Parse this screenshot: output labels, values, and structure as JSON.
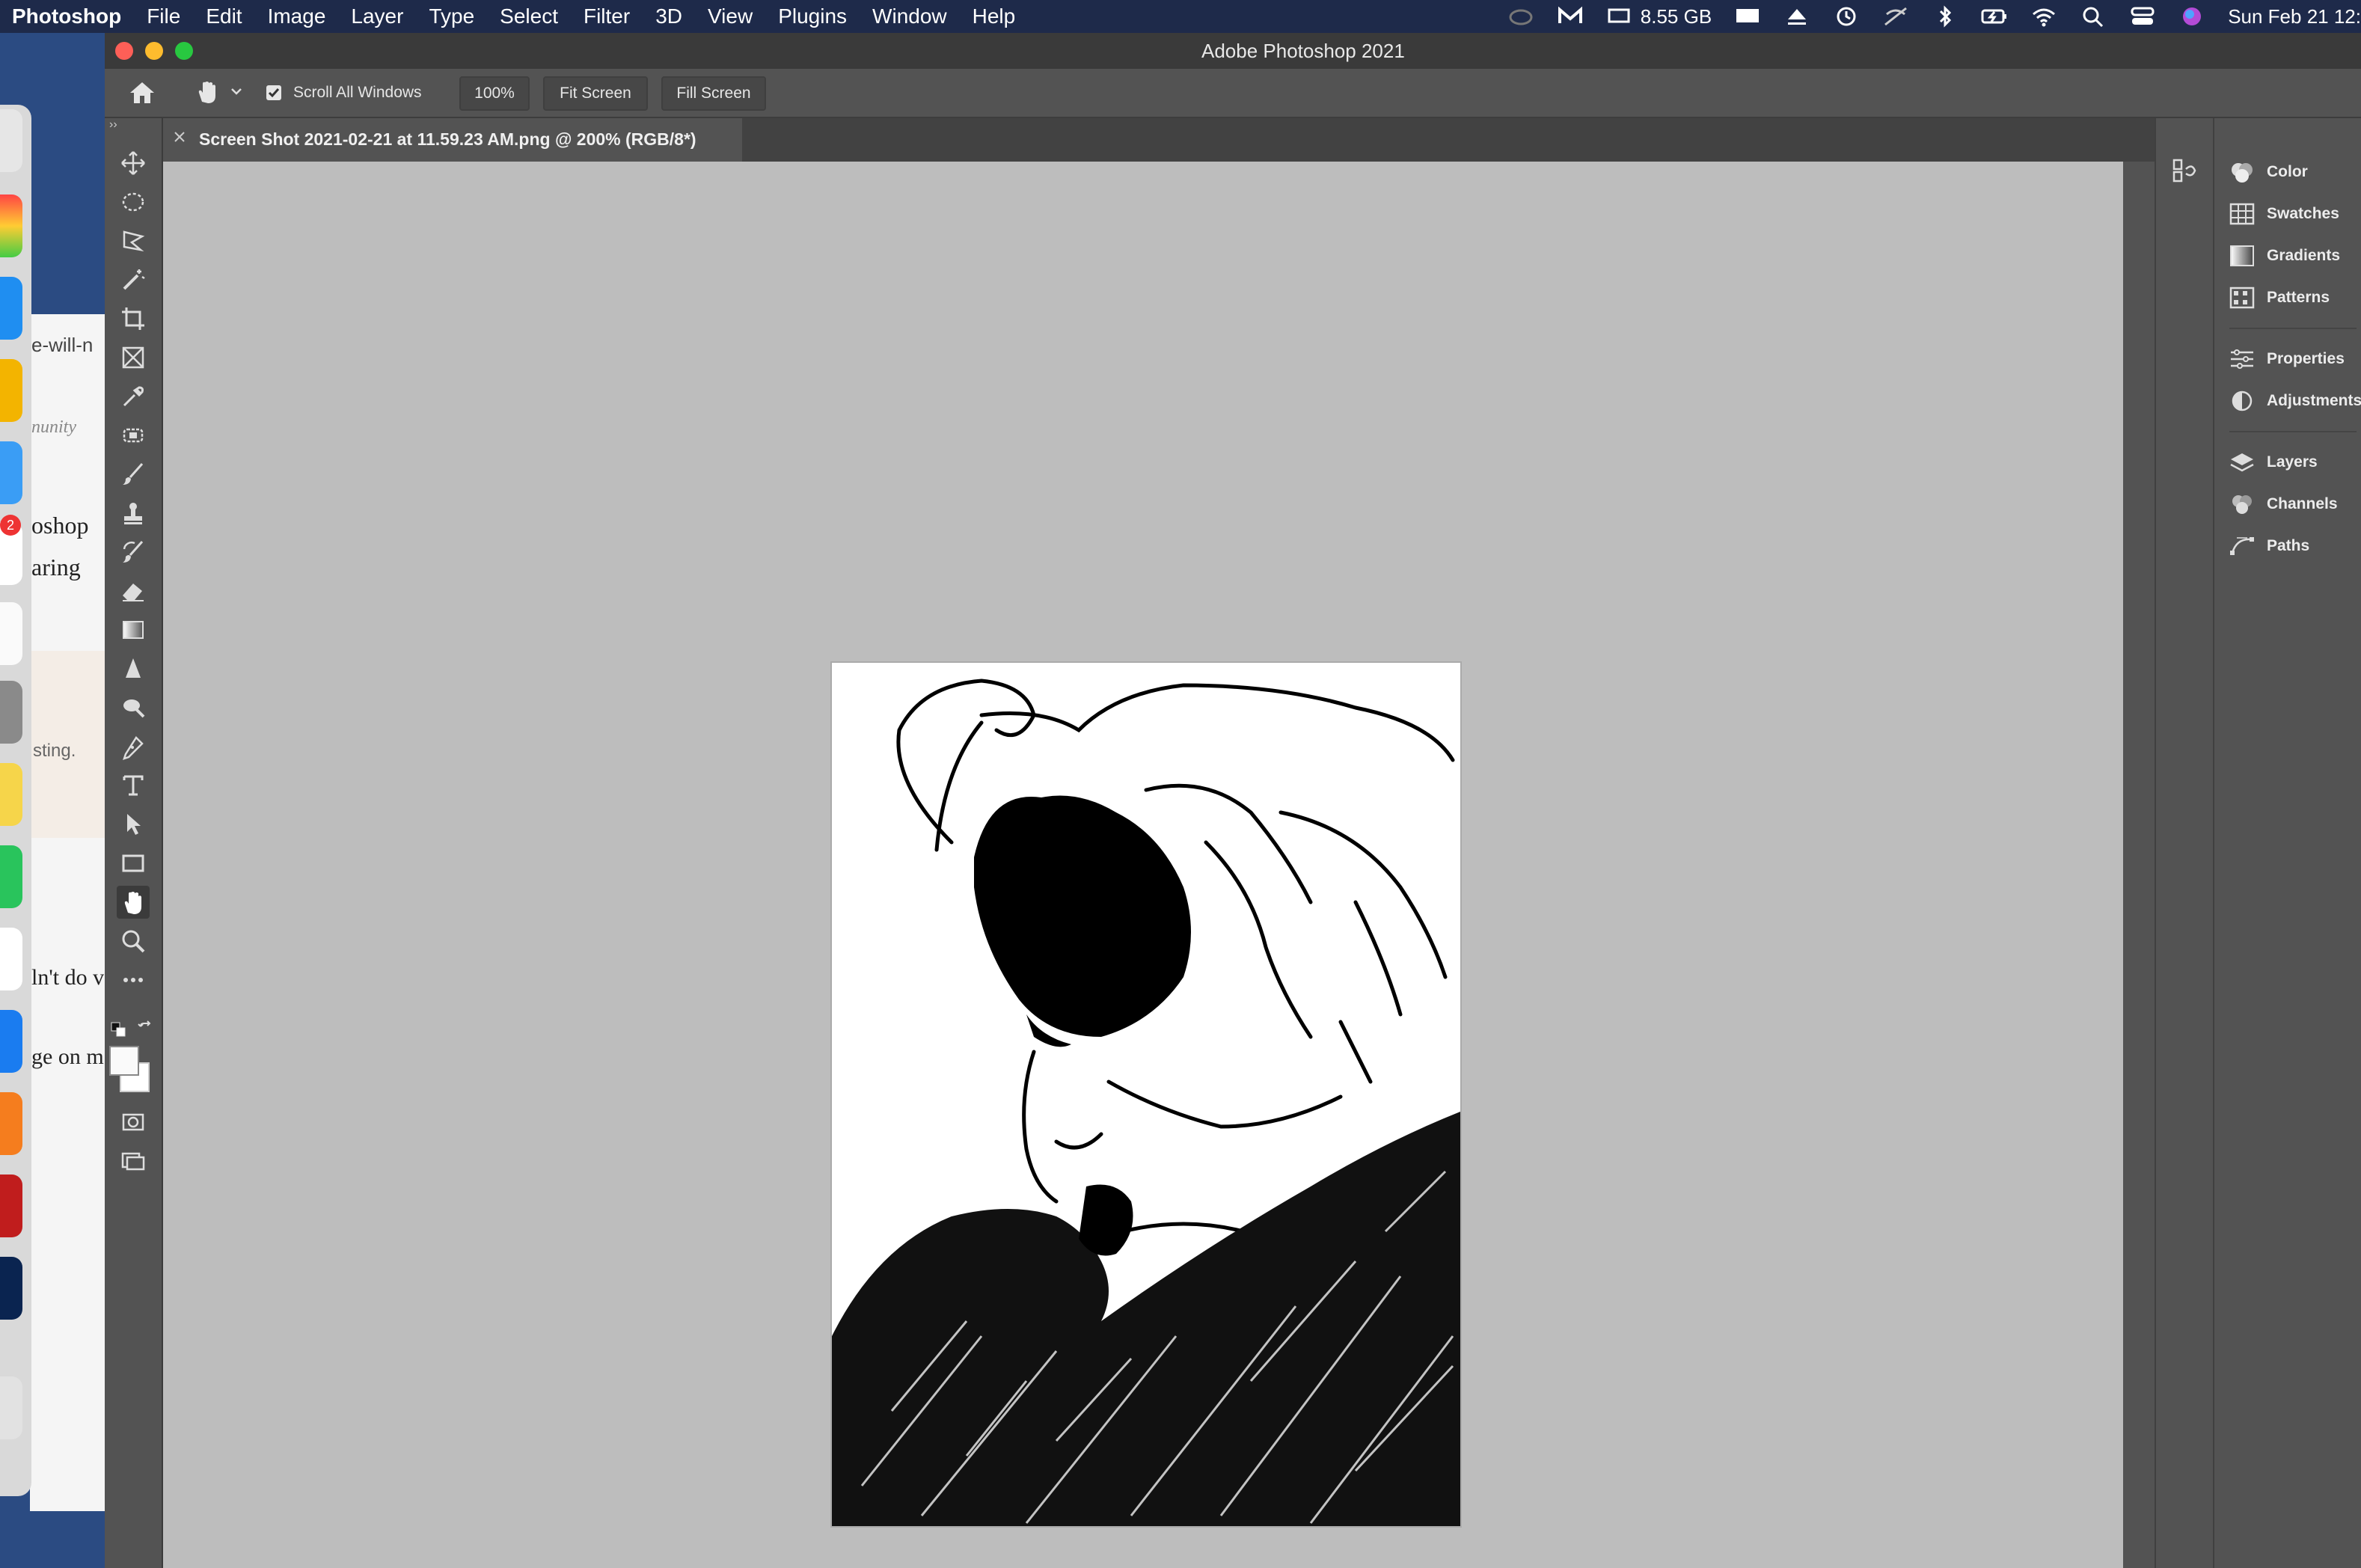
{
  "menubar": {
    "app": "Photoshop",
    "items": [
      "File",
      "Edit",
      "Image",
      "Layer",
      "Type",
      "Select",
      "Filter",
      "3D",
      "View",
      "Plugins",
      "Window",
      "Help"
    ],
    "memory": "8.55 GB",
    "clock": "Sun Feb 21  12:"
  },
  "background": {
    "lines": [
      "e-will-n",
      "nunity",
      "oshop",
      "aring",
      "sting.",
      "ln't do v",
      "ge on m"
    ],
    "badge": "2"
  },
  "window": {
    "title": "Adobe Photoshop 2021"
  },
  "options": {
    "scroll_all": "Scroll All Windows",
    "zoom": "100%",
    "fit_screen": "Fit Screen",
    "fill_screen": "Fill Screen"
  },
  "document": {
    "tab_title": "Screen Shot 2021-02-21 at 11.59.23 AM.png @ 200% (RGB/8*)"
  },
  "panels": [
    "Color",
    "Swatches",
    "Gradients",
    "Patterns",
    "Properties",
    "Adjustments",
    "Layers",
    "Channels",
    "Paths"
  ],
  "colors": {
    "menubar": "#1e2a4a",
    "ps_panel": "#535353",
    "canvas": "#bdbdbd"
  }
}
